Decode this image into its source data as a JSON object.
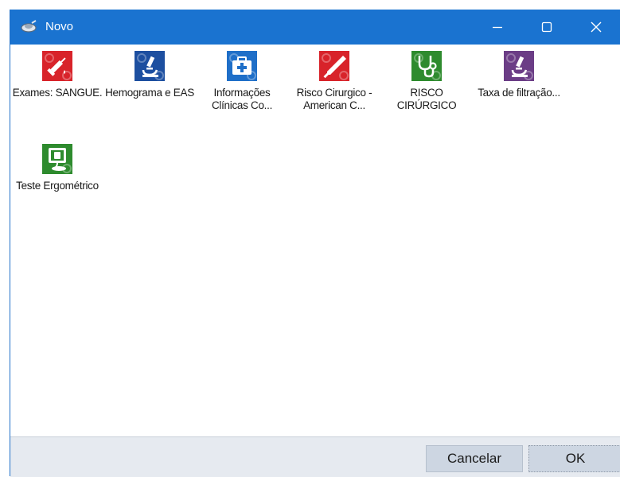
{
  "window": {
    "title": "Novo",
    "title_icon": "app-icon",
    "controls": {
      "minimize": "minimize-icon",
      "maximize": "maximize-icon",
      "close": "close-icon"
    }
  },
  "items": [
    {
      "label": "Exames: SANGUE.",
      "icon": "syringe-icon",
      "color": "#d8232a"
    },
    {
      "label": "Hemograma e EAS",
      "icon": "microscope-icon",
      "color": "#1d4fa0"
    },
    {
      "label": "Informações Clínicas Co...",
      "icon": "first-aid-kit-icon",
      "color": "#1f6fc8"
    },
    {
      "label": "Risco Cirurgico - American C...",
      "icon": "scalpel-icon",
      "color": "#d8232a"
    },
    {
      "label": "RISCO CIRÚRGICO",
      "icon": "stethoscope-icon",
      "color": "#2e8b2e"
    },
    {
      "label": "Taxa de filtração...",
      "icon": "microscope-icon",
      "color": "#6b3d86"
    },
    {
      "label": "Teste Ergométrico",
      "icon": "ecg-monitor-icon",
      "color": "#2e8b2e"
    }
  ],
  "footer": {
    "cancel_label": "Cancelar",
    "ok_label": "OK"
  }
}
